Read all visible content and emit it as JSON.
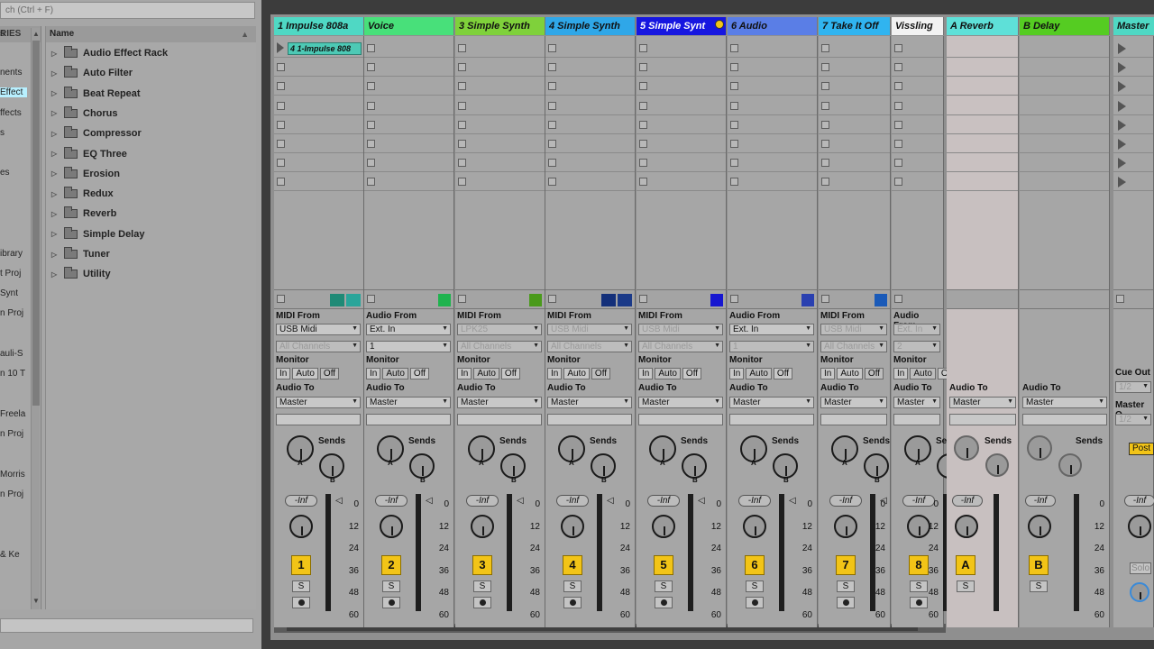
{
  "browser": {
    "search_placeholder": "ch (Ctrl + F)",
    "places_header": "RIES",
    "places": [
      "s",
      "",
      "nents",
      "Effect",
      "ffects",
      "s",
      "",
      "es",
      "",
      "",
      "ibrary",
      "t Proj",
      "Synt",
      "n Proj",
      "",
      "auli-S",
      "n 10 T",
      "",
      "Freela",
      "n Proj",
      "",
      "Morris",
      "n Proj",
      "",
      "& Ke"
    ],
    "selected_place_index": 3,
    "column_name": "Name",
    "items": [
      "Audio Effect Rack",
      "Auto Filter",
      "Beat Repeat",
      "Chorus",
      "Compressor",
      "EQ Three",
      "Erosion",
      "Redux",
      "Reverb",
      "Simple Delay",
      "Tuner",
      "Utility"
    ]
  },
  "tracks": [
    {
      "name": "1 Impulse 808a",
      "color": "#4fd8c4",
      "type": "midi",
      "io_from": "MIDI From",
      "from": "USB Midi",
      "channel": "All Channels",
      "from_dim": false,
      "channel_dim": true,
      "monitor": "Off",
      "to": "Master",
      "num": "1",
      "clip": "4 1-Impulse 808",
      "meter_colors": [
        "#1f8a76",
        "#2aa59a"
      ]
    },
    {
      "name": "Voice",
      "color": "#48e07a",
      "type": "audio",
      "io_from": "Audio From",
      "from": "Ext. In",
      "channel": "1",
      "from_dim": false,
      "channel_dim": false,
      "monitor": "Auto",
      "to": "Master",
      "num": "2",
      "meter_colors": [
        "#1fb34e"
      ]
    },
    {
      "name": "3 Simple Synth",
      "color": "#7fd13b",
      "type": "midi",
      "io_from": "MIDI From",
      "from": "LPK25",
      "channel": "All Channels",
      "from_dim": true,
      "channel_dim": true,
      "monitor": "Auto",
      "to": "Master",
      "num": "3",
      "meter_colors": [
        "#4a9a1b"
      ]
    },
    {
      "name": "4 Simple Synth",
      "color": "#2fa7e8",
      "type": "midi",
      "io_from": "MIDI From",
      "from": "USB Midi",
      "channel": "All Channels",
      "from_dim": true,
      "channel_dim": true,
      "monitor": "Off",
      "to": "Master",
      "num": "4",
      "meter_colors": [
        "#14307a",
        "#1b3a88"
      ]
    },
    {
      "name": "5 Simple Synt",
      "color": "#1616e0",
      "type": "midi",
      "io_from": "MIDI From",
      "from": "USB Midi",
      "channel": "All Channels",
      "from_dim": true,
      "channel_dim": true,
      "monitor": "Auto",
      "to": "Master",
      "num": "5",
      "meter_colors": [
        "#1616d0"
      ],
      "textcolor": "#fff"
    },
    {
      "name": "6 Audio",
      "color": "#5a7ee6",
      "type": "audio",
      "io_from": "Audio From",
      "from": "Ext. In",
      "channel": "1",
      "from_dim": false,
      "channel_dim": true,
      "monitor": "Auto",
      "to": "Master",
      "num": "6",
      "meter_colors": [
        "#2a40b0"
      ]
    },
    {
      "name": "7 Take It Off",
      "color": "#30b4f0",
      "type": "midi",
      "io_from": "MIDI From",
      "from": "USB Midi",
      "channel": "All Channels",
      "from_dim": true,
      "channel_dim": true,
      "monitor": "Off",
      "to": "Master",
      "num": "7",
      "meter_colors": [
        "#1a5ab8"
      ]
    },
    {
      "name": "Vissling",
      "color": "#f2f2f2",
      "type": "audio",
      "io_from": "Audio From",
      "from": "Ext. In",
      "channel": "2",
      "from_dim": true,
      "channel_dim": true,
      "monitor": "Auto",
      "to": "Master",
      "num": "8",
      "meter_colors": []
    }
  ],
  "returns": [
    {
      "name": "A Reverb",
      "color": "#5ee0d8",
      "num": "A",
      "to": "Master"
    },
    {
      "name": "B Delay",
      "color": "#55cc22",
      "num": "B",
      "to": "Master"
    }
  ],
  "master": {
    "name": "Master",
    "color": "#4fd8c4",
    "cue_out": "Cue Out",
    "cue_val": "1/2",
    "master_out": "Master O",
    "master_val": "1/2",
    "post": "Post",
    "solo": "Solo"
  },
  "labels": {
    "monitor": "Monitor",
    "audio_to": "Audio To",
    "sends": "Sends",
    "in": "In",
    "auto": "Auto",
    "off": "Off",
    "vol": "-Inf",
    "solo": "S",
    "send_a": "A",
    "send_b": "B"
  },
  "scale": [
    "0",
    "12",
    "24",
    "36",
    "48",
    "60"
  ]
}
